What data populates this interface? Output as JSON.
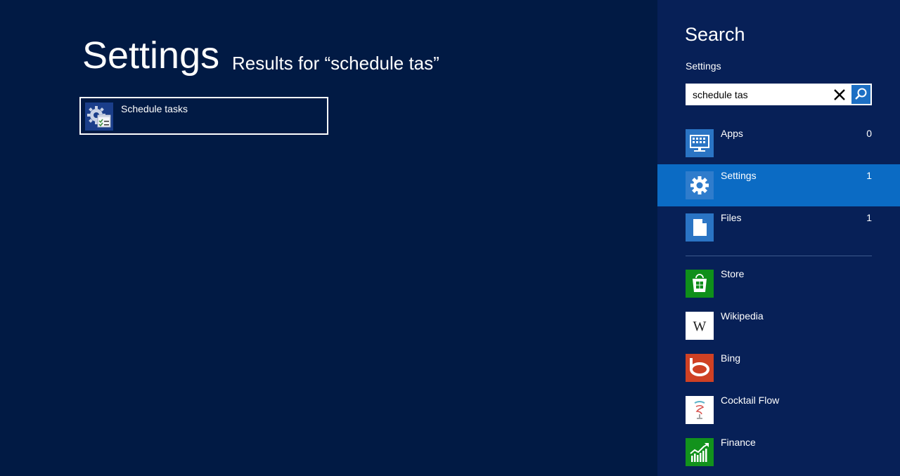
{
  "main": {
    "title": "Settings",
    "results_for": "Results for “schedule tas”",
    "results": [
      {
        "label": "Schedule tasks",
        "icon": "schedule-tasks-icon"
      }
    ]
  },
  "search_panel": {
    "title": "Search",
    "scope": "Settings",
    "query": "schedule tas",
    "clear_icon": "close-icon",
    "search_icon": "search-icon",
    "scopes": [
      {
        "label": "Apps",
        "count": "0",
        "icon": "apps-icon"
      },
      {
        "label": "Settings",
        "count": "1",
        "icon": "gear-icon",
        "selected": true
      },
      {
        "label": "Files",
        "count": "1",
        "icon": "file-icon"
      }
    ],
    "apps": [
      {
        "label": "Store",
        "icon": "store-icon",
        "color": "#0f8f1a"
      },
      {
        "label": "Wikipedia",
        "icon": "wikipedia-icon",
        "color": "#ffffff"
      },
      {
        "label": "Bing",
        "icon": "bing-icon",
        "color": "#cf4124"
      },
      {
        "label": "Cocktail Flow",
        "icon": "cocktail-flow-icon",
        "color": "#ffffff"
      },
      {
        "label": "Finance",
        "icon": "finance-icon",
        "color": "#12921c"
      }
    ]
  },
  "colors": {
    "background": "#011a44",
    "panel": "#072057",
    "selected": "#0b6bc4",
    "accent": "#1d6fc4"
  }
}
